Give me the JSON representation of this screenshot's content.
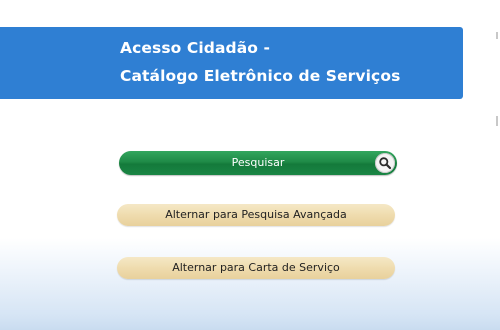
{
  "header": {
    "title_line1": "Acesso Cidadão -",
    "title_line2": "Catálogo Eletrônico de Serviços"
  },
  "actions": {
    "search_label": "Pesquisar",
    "search_icon": "magnifier-icon",
    "advanced_search_label": "Alternar para Pesquisa Avançada",
    "service_card_label": "Alternar para Carta de Serviço"
  },
  "colors": {
    "header_background": "#2f7fd3",
    "search_button": "#1f8a47",
    "secondary_button": "#efdcae"
  }
}
